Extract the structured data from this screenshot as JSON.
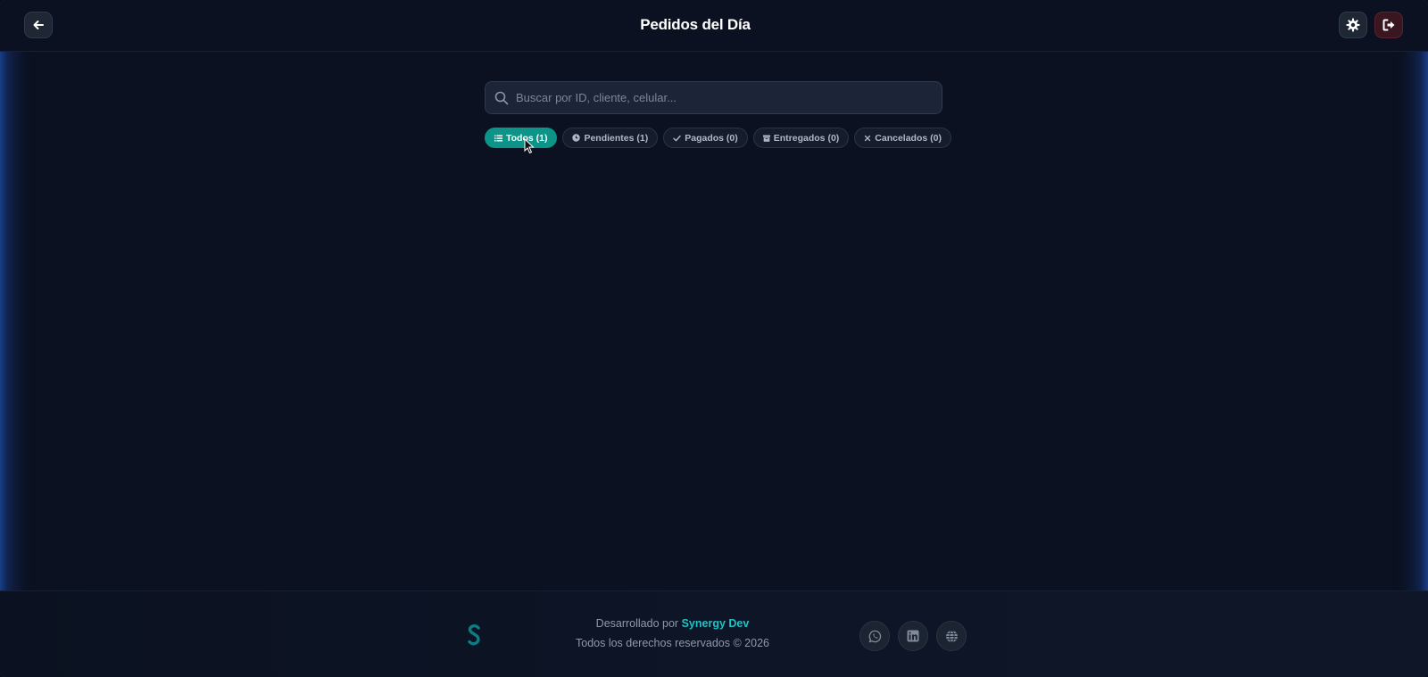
{
  "header": {
    "title": "Pedidos del Día",
    "back_icon": "arrow-left-icon",
    "settings_icon": "gear-icon",
    "logout_icon": "logout-icon"
  },
  "search": {
    "placeholder": "Buscar por ID, cliente, celular...",
    "value": ""
  },
  "filters": [
    {
      "label": "Todos (1)",
      "icon": "list-icon",
      "active": true
    },
    {
      "label": "Pendientes (1)",
      "icon": "clock-icon",
      "active": false
    },
    {
      "label": "Pagados (0)",
      "icon": "check-icon",
      "active": false
    },
    {
      "label": "Entregados (0)",
      "icon": "box-icon",
      "active": false
    },
    {
      "label": "Cancelados (0)",
      "icon": "x-icon",
      "active": false
    }
  ],
  "footer": {
    "developed_by": "Desarrollado por",
    "brand": "Synergy Dev",
    "rights": "Todos los derechos reservados © 2026",
    "social": [
      "whatsapp-icon",
      "linkedin-icon",
      "globe-icon"
    ]
  },
  "colors": {
    "accent": "#0d9488",
    "brand": "#22c1c3",
    "background": "#0b1120",
    "logout": "#3a1620"
  }
}
